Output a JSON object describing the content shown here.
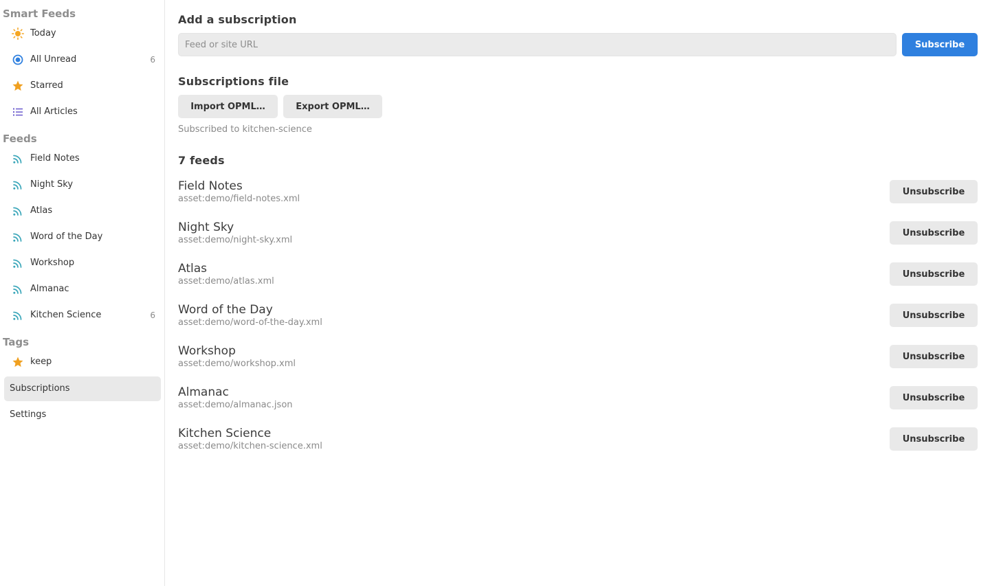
{
  "sidebar": {
    "smart_feeds_title": "Smart Feeds",
    "smart_feeds": [
      {
        "label": "Today",
        "icon": "sun-icon",
        "count": ""
      },
      {
        "label": "All Unread",
        "icon": "unread-circle-icon",
        "count": "6"
      },
      {
        "label": "Starred",
        "icon": "star-icon",
        "count": ""
      },
      {
        "label": "All Articles",
        "icon": "list-icon",
        "count": ""
      }
    ],
    "feeds_title": "Feeds",
    "feeds": [
      {
        "label": "Field Notes",
        "icon": "rss-icon",
        "count": ""
      },
      {
        "label": "Night Sky",
        "icon": "rss-icon",
        "count": ""
      },
      {
        "label": "Atlas",
        "icon": "rss-icon",
        "count": ""
      },
      {
        "label": "Word of the Day",
        "icon": "rss-icon",
        "count": ""
      },
      {
        "label": "Workshop",
        "icon": "rss-icon",
        "count": ""
      },
      {
        "label": "Almanac",
        "icon": "rss-icon",
        "count": ""
      },
      {
        "label": "Kitchen Science",
        "icon": "rss-icon",
        "count": "6"
      }
    ],
    "tags_title": "Tags",
    "tags": [
      {
        "label": "keep",
        "icon": "star-icon"
      }
    ],
    "subscriptions_label": "Subscriptions",
    "settings_label": "Settings"
  },
  "main": {
    "add_title": "Add a subscription",
    "url_placeholder": "Feed or site URL",
    "url_value": "",
    "subscribe_label": "Subscribe",
    "file_title": "Subscriptions file",
    "import_label": "Import OPML…",
    "export_label": "Export OPML…",
    "status_text": "Subscribed to kitchen-science",
    "feeds_count_title": "7 feeds",
    "unsubscribe_label": "Unsubscribe",
    "feeds": [
      {
        "name": "Field Notes",
        "url": "asset:demo/field-notes.xml"
      },
      {
        "name": "Night Sky",
        "url": "asset:demo/night-sky.xml"
      },
      {
        "name": "Atlas",
        "url": "asset:demo/atlas.xml"
      },
      {
        "name": "Word of the Day",
        "url": "asset:demo/word-of-the-day.xml"
      },
      {
        "name": "Workshop",
        "url": "asset:demo/workshop.xml"
      },
      {
        "name": "Almanac",
        "url": "asset:demo/almanac.json"
      },
      {
        "name": "Kitchen Science",
        "url": "asset:demo/kitchen-science.xml"
      }
    ]
  },
  "colors": {
    "accent": "#2f80df",
    "sun": "#f5a623",
    "star": "#f0a020",
    "unread": "#2f80df",
    "list": "#6a5acd",
    "rss": "#3aa6b9"
  }
}
